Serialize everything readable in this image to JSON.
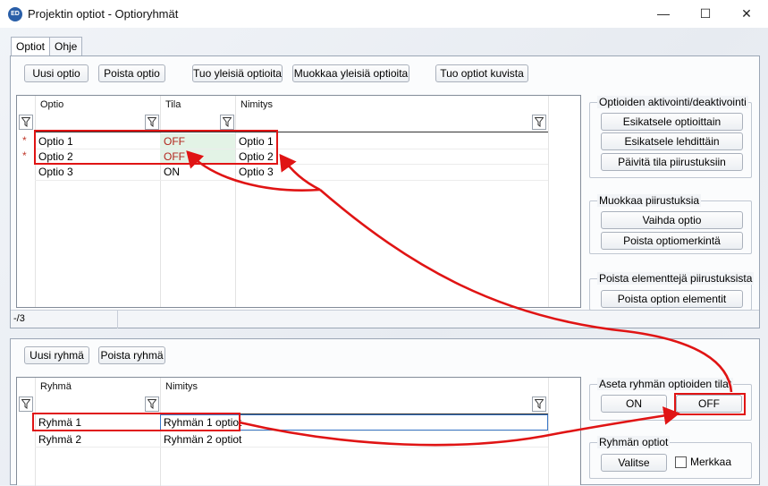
{
  "window": {
    "title": "Projektin optiot - Optioryhmät",
    "icon_text": "ED",
    "minimize": "—",
    "maximize": "☐",
    "close": "✕"
  },
  "tabs": [
    {
      "label": "Optiot"
    },
    {
      "label": "Ohje"
    }
  ],
  "toolbar": {
    "new_option": "Uusi optio",
    "delete_option": "Poista optio",
    "import_common": "Tuo yleisiä optioita",
    "edit_common": "Muokkaa yleisiä optioita",
    "import_from_images": "Tuo optiot kuvista"
  },
  "options_grid": {
    "columns": [
      "Optio",
      "Tila",
      "Nimitys"
    ],
    "rows": [
      {
        "marker": "*",
        "name": "Optio 1",
        "state": "OFF",
        "title": "Optio 1"
      },
      {
        "marker": "*",
        "name": "Optio 2",
        "state": "OFF",
        "title": "Optio 2"
      },
      {
        "marker": "",
        "name": "Optio 3",
        "state": "ON",
        "title": "Optio 3"
      }
    ],
    "status": "-/3"
  },
  "activation_group": {
    "title": "Optioiden aktivointi/deaktivointi",
    "preview_by_option": "Esikatsele optioittain",
    "preview_by_sheet": "Esikatsele lehdittäin",
    "update_state": "Päivitä tila piirustuksiin"
  },
  "edit_drawings_group": {
    "title": "Muokkaa piirustuksia",
    "change_option": "Vaihda optio",
    "remove_marking": "Poista optiomerkintä"
  },
  "remove_elements_group": {
    "title": "Poista elementtejä piirustuksista",
    "remove_option_elements": "Poista option elementit"
  },
  "group_toolbar": {
    "new_group": "Uusi ryhmä",
    "delete_group": "Poista ryhmä"
  },
  "groups_grid": {
    "columns": [
      "Ryhmä",
      "Nimitys"
    ],
    "rows": [
      {
        "name": "Ryhmä 1",
        "title": "Ryhmän 1 optiot"
      },
      {
        "name": "Ryhmä 2",
        "title": "Ryhmän 2 optiot"
      }
    ]
  },
  "group_state_group": {
    "title": "Aseta ryhmän optioiden tilat",
    "on": "ON",
    "off": "OFF"
  },
  "group_options_group": {
    "title": "Ryhmän optiot",
    "select": "Valitse",
    "mark": "Merkkaa",
    "mark_checked": false
  },
  "colors": {
    "annotation_red": "#e01414",
    "off_text": "#b3261e",
    "off_cell_bg": "#e3f3e6"
  }
}
